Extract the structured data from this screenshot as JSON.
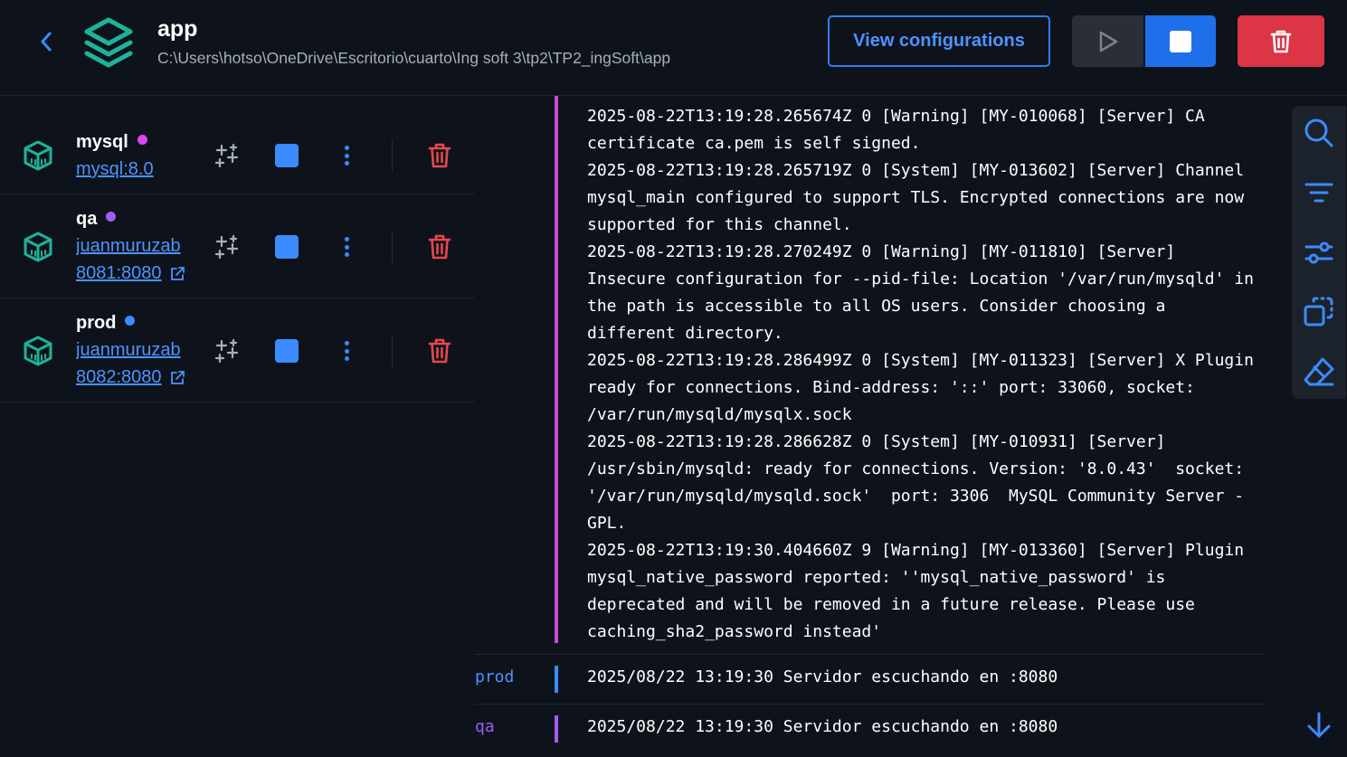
{
  "header": {
    "title": "app",
    "path": "C:\\Users\\hotso\\OneDrive\\Escritorio\\cuarto\\Ing soft 3\\tp2\\TP2_ingSoft\\app",
    "view_config_label": "View configurations"
  },
  "icons": {
    "back": "chevron-left-icon",
    "logo": "layers-icon",
    "play": "play-icon",
    "stop": "stop-icon",
    "delete": "trash-icon",
    "container": "cube-icon",
    "ai": "sparkles-icon",
    "more": "kebab-menu-icon",
    "external": "external-link-icon",
    "search": "search-icon",
    "filter": "filter-icon",
    "settings": "sliders-icon",
    "copy": "copy-icon",
    "clear": "eraser-icon",
    "scroll": "arrow-down-icon"
  },
  "colors": {
    "accent": "#1f6feb",
    "danger": "#dc3545",
    "container_icon": "#1fb29a",
    "mysql_dot": "#d946ef",
    "qa_dot": "#a35cf0",
    "prod_dot": "#3b8bff"
  },
  "containers": [
    {
      "name": "mysql",
      "image": "mysql:8.0"
    },
    {
      "name": "qa",
      "image": "juanmuruzab",
      "port": "8081:8080"
    },
    {
      "name": "prod",
      "image": "juanmuruzab",
      "port": "8082:8080"
    }
  ],
  "logs": {
    "mysql_block": "2025-08-22T13:19:28.265674Z 0 [Warning] [MY-010068] [Server] CA\ncertificate ca.pem is self signed.\n2025-08-22T13:19:28.265719Z 0 [System] [MY-013602] [Server] Channel\nmysql_main configured to support TLS. Encrypted connections are now\nsupported for this channel.\n2025-08-22T13:19:28.270249Z 0 [Warning] [MY-011810] [Server]\nInsecure configuration for --pid-file: Location '/var/run/mysqld' in\nthe path is accessible to all OS users. Consider choosing a\ndifferent directory.\n2025-08-22T13:19:28.286499Z 0 [System] [MY-011323] [Server] X Plugin\nready for connections. Bind-address: '::' port: 33060, socket:\n/var/run/mysqld/mysqlx.sock\n2025-08-22T13:19:28.286628Z 0 [System] [MY-010931] [Server]\n/usr/sbin/mysqld: ready for connections. Version: '8.0.43'  socket:\n'/var/run/mysqld/mysqld.sock'  port: 3306  MySQL Community Server -\nGPL.\n2025-08-22T13:19:30.404660Z 9 [Warning] [MY-013360] [Server] Plugin\nmysql_native_password reported: ''mysql_native_password' is\ndeprecated and will be removed in a future release. Please use\ncaching_sha2_password instead'",
    "rows": [
      {
        "source": "prod",
        "message": "2025/08/22 13:19:30 Servidor escuchando en :8080",
        "color": "#4d93ff"
      },
      {
        "source": "qa",
        "message": "2025/08/22 13:19:30 Servidor escuchando en :8080",
        "color": "#a35cf0"
      }
    ]
  }
}
